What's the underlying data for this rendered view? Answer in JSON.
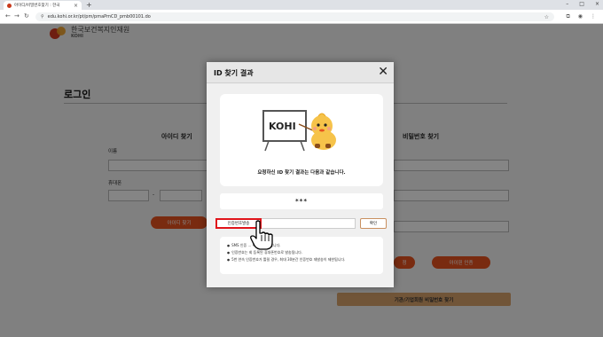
{
  "browser": {
    "tab_title": "아이디/비밀번호찾기 : 한국",
    "tab_close": "×",
    "new_tab": "+",
    "url": "edu.kohi.or.kr/pt/pm/pmaPmCD_pmb00101.do",
    "window_controls": [
      "–",
      "□",
      "×"
    ]
  },
  "page": {
    "logo_text": "한국보건복지인재원",
    "logo_sub": "KOHI",
    "title": "로그인",
    "left_section_title": "아이디 찾기",
    "right_section_title": "비밀번호 찾기",
    "name_label": "이름",
    "phone_label": "휴대폰",
    "phone_dash": "-",
    "find_id_button": "아이디 찾기",
    "right_button_1": "정",
    "right_button_2": "아이핀 인증",
    "bottom_button": "기관/기업회원 비밀번호 찾기"
  },
  "modal": {
    "title": "ID 찾기 결과",
    "close": "✕",
    "mascot_board_text": "KOHI",
    "result_message": "요청하신 ID 찾기 결과는 다음과 같습니다.",
    "found_id": "***",
    "sms_button": "인증번호발송",
    "confirm_button": "확인",
    "notices": [
      "SMS 인증 ...  확인이 가능합니다.",
      "인증번호는 회  등록된 휴대폰번호로 발송됩니다.",
      "5번 연속 인증번호가 틀릴 경우, 최대 30분간 인증번호 재발송이 제한됩니다."
    ]
  },
  "colors": {
    "accent_orange": "#e8541f",
    "tan": "#d9a36c",
    "highlight_red": "#e0141a"
  }
}
